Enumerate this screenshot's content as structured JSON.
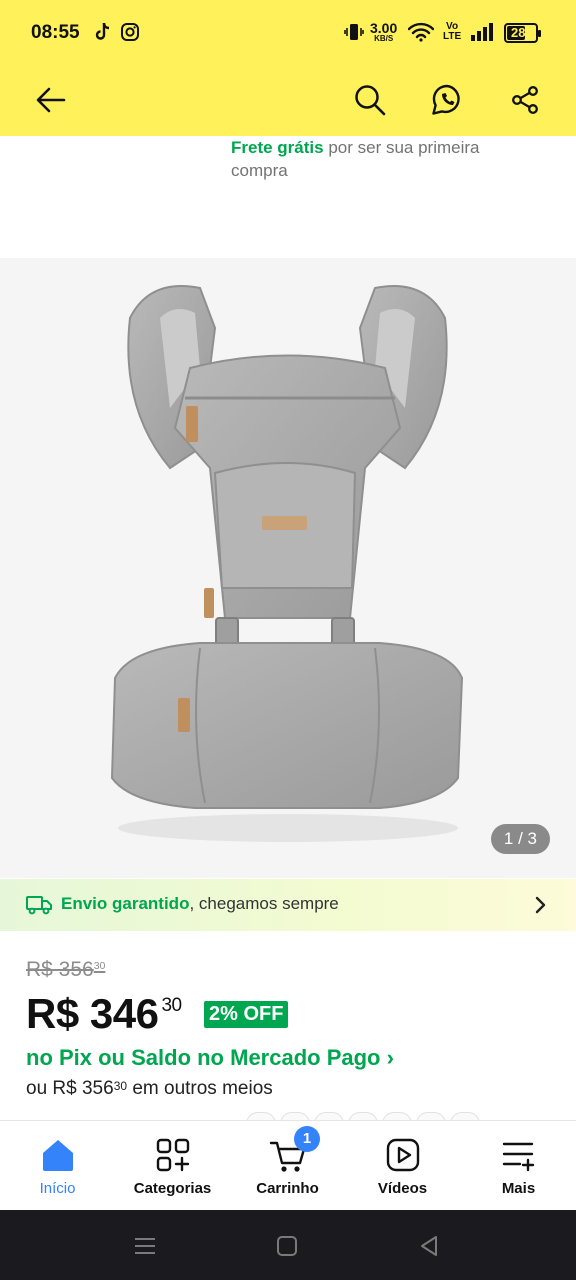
{
  "status_bar": {
    "time": "08:55",
    "speed_value": "3.00",
    "speed_unit": "KB/S",
    "volte_top": "Vo",
    "volte_bottom": "LTE",
    "battery": "28"
  },
  "header": {
    "icons": [
      "back-arrow-icon",
      "search-icon",
      "whatsapp-icon",
      "share-icon"
    ]
  },
  "shipping_note": {
    "highlight": "Frete grátis",
    "text": " por ser sua primeira compra"
  },
  "gallery": {
    "counter": "1 / 3"
  },
  "guarantee": {
    "highlight": "Envio garantido",
    "text": ", chegamos sempre"
  },
  "pricing": {
    "old_main": "R$ 356",
    "old_cents": "30",
    "price_main": "R$ 346",
    "price_cents": "30",
    "discount": "2% OFF",
    "pix_label": "no Pix ou Saldo no Mercado Pago ›",
    "alt_prefix": "ou R$ 356",
    "alt_cents": "30",
    "alt_suffix": " em outros meios"
  },
  "bottom_nav": {
    "items": [
      {
        "label": "Início",
        "icon": "home-icon",
        "active": true
      },
      {
        "label": "Categorias",
        "icon": "categories-icon"
      },
      {
        "label": "Carrinho",
        "icon": "cart-icon",
        "badge": "1"
      },
      {
        "label": "Vídeos",
        "icon": "video-icon"
      },
      {
        "label": "Mais",
        "icon": "more-icon"
      }
    ]
  },
  "colors": {
    "header_bg": "#fff159",
    "accent_blue": "#3483fa",
    "green": "#00a650"
  }
}
